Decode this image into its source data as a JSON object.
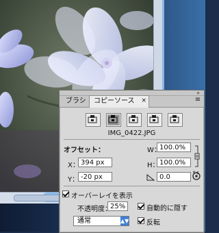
{
  "panel": {
    "tab_brush": "ブラシ",
    "tab_clone_source": "コピーソース",
    "tab_close_glyph": "×",
    "menu_glyph": "≡",
    "filename": "IMG_0422.JPG",
    "offset_label": "オフセット：",
    "x_label": "X：",
    "x_value": "394 px",
    "y_label": "Y：",
    "y_value": "-20 px",
    "w_label": "W：",
    "w_value": "100.0%",
    "h_label": "H：",
    "h_value": "100.0%",
    "angle_value": "0.0",
    "angle_unit": "°",
    "show_overlay_label": "オーバーレイを表示",
    "opacity_label": "不透明度：",
    "opacity_value": "25%",
    "auto_hide_label": "自動的に隠す",
    "blend_mode": "通常",
    "invert_label": "反転"
  },
  "icons": {
    "clone_sources": [
      "clone-source-1-icon",
      "clone-source-2-icon",
      "clone-source-3-icon",
      "clone-source-4-icon",
      "clone-source-5-icon"
    ],
    "link": "chain-link-icon",
    "angle": "angle-icon",
    "reset": "rotate-reset-icon"
  },
  "colors": {
    "panel_bg": "#d8d8d8",
    "accent": "#3f7fd6",
    "window_edge": "#8db6e6"
  }
}
